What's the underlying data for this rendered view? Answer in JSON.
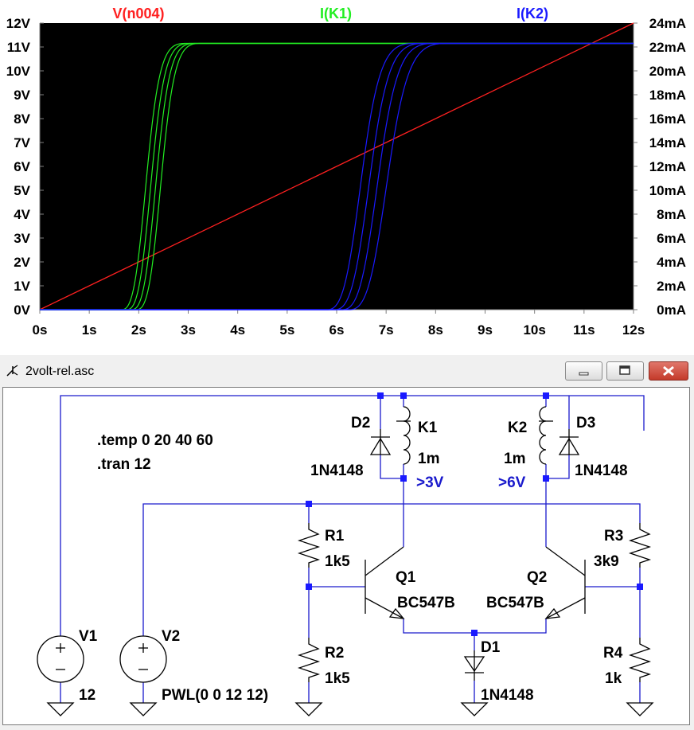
{
  "plot": {
    "traces": [
      {
        "name": "V(n004)",
        "color": "#ff2020"
      },
      {
        "name": "I(K1)",
        "color": "#22ee22"
      },
      {
        "name": "I(K2)",
        "color": "#1a1aff"
      }
    ],
    "left_axis_ticks": [
      "0V",
      "1V",
      "2V",
      "3V",
      "4V",
      "5V",
      "6V",
      "7V",
      "8V",
      "9V",
      "10V",
      "11V",
      "12V"
    ],
    "right_axis_ticks": [
      "0mA",
      "2mA",
      "4mA",
      "6mA",
      "8mA",
      "10mA",
      "12mA",
      "14mA",
      "16mA",
      "18mA",
      "20mA",
      "22mA",
      "24mA"
    ],
    "x_axis_ticks": [
      "0s",
      "1s",
      "2s",
      "3s",
      "4s",
      "5s",
      "6s",
      "7s",
      "8s",
      "9s",
      "10s",
      "11s",
      "12s"
    ]
  },
  "chart_data": {
    "type": "line",
    "x_range": [
      0,
      12
    ],
    "y_left_range": [
      0,
      12
    ],
    "y_right_range": [
      0,
      24
    ],
    "background": "#000000",
    "grid": false,
    "series": [
      {
        "name": "V(n004)",
        "axis": "left",
        "unit": "V",
        "x": [
          0,
          12
        ],
        "y": [
          0,
          12
        ]
      },
      {
        "name": "I(K1)",
        "axis": "right",
        "unit": "mA",
        "steps": [
          {
            "x_start": 1.65,
            "x_mid": 2.55,
            "x_end": 2.95
          },
          {
            "x_start": 1.75,
            "x_mid": 2.65,
            "x_end": 3.05
          },
          {
            "x_start": 1.85,
            "x_mid": 2.75,
            "x_end": 3.15
          },
          {
            "x_start": 1.95,
            "x_mid": 2.85,
            "x_end": 3.25
          }
        ],
        "low": 0,
        "high": 22.3
      },
      {
        "name": "I(K2)",
        "axis": "right",
        "unit": "mA",
        "steps": [
          {
            "x_start": 5.8,
            "x_mid": 6.95,
            "x_end": 7.6
          },
          {
            "x_start": 5.95,
            "x_mid": 7.1,
            "x_end": 7.8
          },
          {
            "x_start": 6.1,
            "x_mid": 7.25,
            "x_end": 8.0
          },
          {
            "x_start": 6.25,
            "x_mid": 7.45,
            "x_end": 8.25
          }
        ],
        "low": 0,
        "high": 22.3
      }
    ]
  },
  "window": {
    "title": "2volt-rel.asc",
    "minimize_icon": "minimize-icon",
    "maximize_icon": "maximize-icon",
    "close_icon": "close-icon"
  },
  "schematic": {
    "directives": [
      ".temp 0 20 40 60",
      ".tran 12"
    ],
    "components": {
      "D2": {
        "name": "D2",
        "value": "1N4148"
      },
      "K1": {
        "name": "K1",
        "value": "1m",
        "threshold": ">3V"
      },
      "K2": {
        "name": "K2",
        "value": "1m",
        "threshold": ">6V"
      },
      "D3": {
        "name": "D3",
        "value": "1N4148"
      },
      "R1": {
        "name": "R1",
        "value": "1k5"
      },
      "R2": {
        "name": "R2",
        "value": "1k5"
      },
      "R3": {
        "name": "R3",
        "value": "3k9"
      },
      "R4": {
        "name": "R4",
        "value": "1k"
      },
      "Q1": {
        "name": "Q1",
        "value": "BC547B"
      },
      "Q2": {
        "name": "Q2",
        "value": "BC547B"
      },
      "D1": {
        "name": "D1",
        "value": "1N4148"
      },
      "V1": {
        "name": "V1",
        "value": "12"
      },
      "V2": {
        "name": "V2",
        "value": "PWL(0 0 12 12)"
      }
    },
    "wire_color": "#1a1acc",
    "node_color": "#1a1aff"
  }
}
